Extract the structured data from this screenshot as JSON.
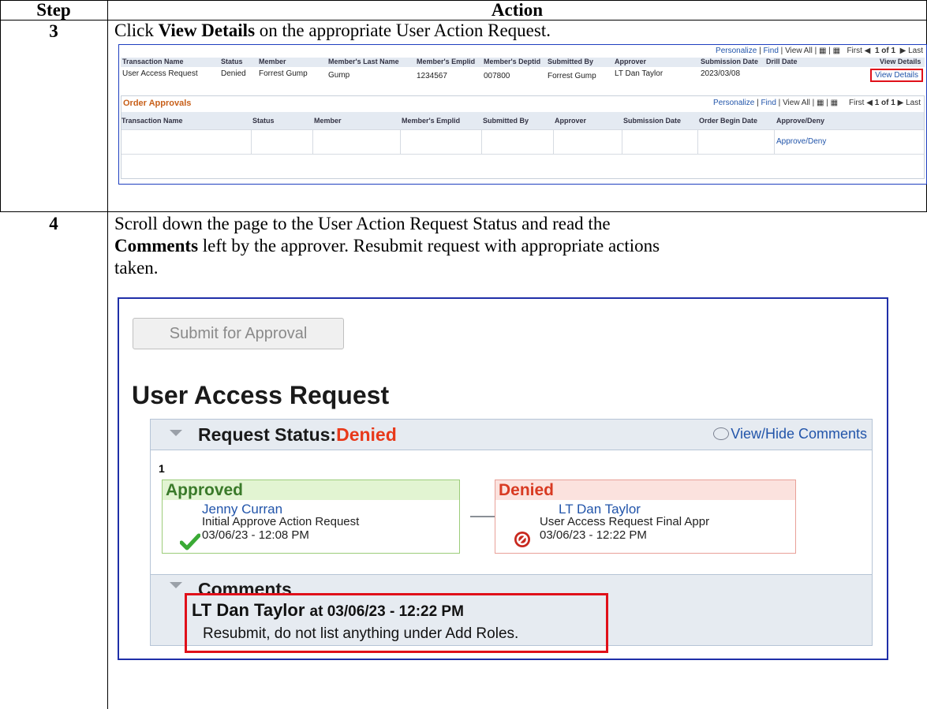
{
  "header": {
    "step": "Step",
    "action": "Action"
  },
  "step3": {
    "num": "3",
    "text_pre": "Click ",
    "text_bold": "View Details",
    "text_post": " on the appropriate User Action Request.",
    "screenshot": {
      "nav": {
        "personalize": "Personalize",
        "find": "Find",
        "view_all": "View All",
        "first": "First",
        "count": "1 of 1",
        "last": "Last"
      },
      "columns": [
        "Transaction Name",
        "Status",
        "Member",
        "Member's Last Name",
        "Member's Emplid",
        "Member's Deptid",
        "Submitted By",
        "Approver",
        "Submission Date",
        "Drill Date",
        "View Details"
      ],
      "row": [
        "User Access Request",
        "Denied",
        "Forrest Gump",
        "Gump",
        "1234567",
        "007800",
        "Forrest Gump",
        "LT Dan Taylor",
        "2023/03/08",
        "",
        "View Details"
      ],
      "order_approvals": {
        "title": "Order Approvals",
        "nav": {
          "personalize": "Personalize",
          "find": "Find",
          "view_all": "View All",
          "first": "First",
          "count": "1 of 1",
          "last": "Last"
        },
        "columns": [
          "Transaction Name",
          "Status",
          "Member",
          "Member's Emplid",
          "Submitted By",
          "Approver",
          "Submission Date",
          "Order Begin Date",
          "Approve/Deny"
        ],
        "approve_deny_link": "Approve/Deny"
      }
    }
  },
  "step4": {
    "num": "4",
    "line1": "Scroll down the page to the User Action Request Status and read the",
    "line2_bold": "Comments",
    "line2_rest": " left by the approver. Resubmit request with appropriate actions",
    "line3": "taken.",
    "screenshot": {
      "submit_button": "Submit for Approval",
      "title": "User Access Request",
      "status_label": "Request Status:",
      "status_value": "Denied",
      "view_hide": "View/Hide Comments",
      "sequence": "1",
      "approved_card": {
        "header": "Approved",
        "name": "Jenny Curran",
        "action": "Initial Approve Action Request",
        "datetime": "03/06/23 - 12:08 PM"
      },
      "denied_card": {
        "header": "Denied",
        "name": "LT Dan Taylor",
        "action": "User Access Request Final Appr",
        "datetime": "03/06/23 - 12:22 PM"
      },
      "comments_label": "Comments",
      "comment": {
        "author": "LT Dan Taylor",
        "at": "at 03/06/23 - 12:22 PM",
        "text": "Resubmit, do not list anything under Add Roles."
      }
    }
  },
  "colors": {
    "denied_red": "#e8391a",
    "link_blue": "#2255aa",
    "highlight_red": "#e0101a",
    "approved_green": "#3aaa35"
  }
}
